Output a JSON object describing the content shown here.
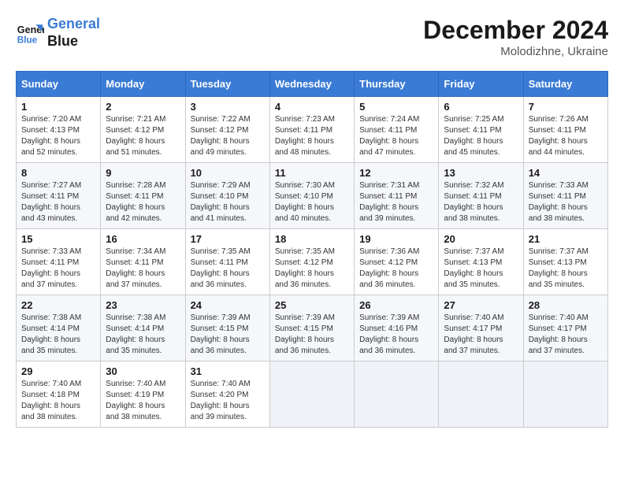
{
  "header": {
    "logo_line1": "General",
    "logo_line2": "Blue",
    "month": "December 2024",
    "location": "Molodizhne, Ukraine"
  },
  "weekdays": [
    "Sunday",
    "Monday",
    "Tuesday",
    "Wednesday",
    "Thursday",
    "Friday",
    "Saturday"
  ],
  "weeks": [
    [
      {
        "day": "1",
        "sunrise": "7:20 AM",
        "sunset": "4:13 PM",
        "daylight": "8 hours and 52 minutes."
      },
      {
        "day": "2",
        "sunrise": "7:21 AM",
        "sunset": "4:12 PM",
        "daylight": "8 hours and 51 minutes."
      },
      {
        "day": "3",
        "sunrise": "7:22 AM",
        "sunset": "4:12 PM",
        "daylight": "8 hours and 49 minutes."
      },
      {
        "day": "4",
        "sunrise": "7:23 AM",
        "sunset": "4:11 PM",
        "daylight": "8 hours and 48 minutes."
      },
      {
        "day": "5",
        "sunrise": "7:24 AM",
        "sunset": "4:11 PM",
        "daylight": "8 hours and 47 minutes."
      },
      {
        "day": "6",
        "sunrise": "7:25 AM",
        "sunset": "4:11 PM",
        "daylight": "8 hours and 45 minutes."
      },
      {
        "day": "7",
        "sunrise": "7:26 AM",
        "sunset": "4:11 PM",
        "daylight": "8 hours and 44 minutes."
      }
    ],
    [
      {
        "day": "8",
        "sunrise": "7:27 AM",
        "sunset": "4:11 PM",
        "daylight": "8 hours and 43 minutes."
      },
      {
        "day": "9",
        "sunrise": "7:28 AM",
        "sunset": "4:11 PM",
        "daylight": "8 hours and 42 minutes."
      },
      {
        "day": "10",
        "sunrise": "7:29 AM",
        "sunset": "4:10 PM",
        "daylight": "8 hours and 41 minutes."
      },
      {
        "day": "11",
        "sunrise": "7:30 AM",
        "sunset": "4:10 PM",
        "daylight": "8 hours and 40 minutes."
      },
      {
        "day": "12",
        "sunrise": "7:31 AM",
        "sunset": "4:11 PM",
        "daylight": "8 hours and 39 minutes."
      },
      {
        "day": "13",
        "sunrise": "7:32 AM",
        "sunset": "4:11 PM",
        "daylight": "8 hours and 38 minutes."
      },
      {
        "day": "14",
        "sunrise": "7:33 AM",
        "sunset": "4:11 PM",
        "daylight": "8 hours and 38 minutes."
      }
    ],
    [
      {
        "day": "15",
        "sunrise": "7:33 AM",
        "sunset": "4:11 PM",
        "daylight": "8 hours and 37 minutes."
      },
      {
        "day": "16",
        "sunrise": "7:34 AM",
        "sunset": "4:11 PM",
        "daylight": "8 hours and 37 minutes."
      },
      {
        "day": "17",
        "sunrise": "7:35 AM",
        "sunset": "4:11 PM",
        "daylight": "8 hours and 36 minutes."
      },
      {
        "day": "18",
        "sunrise": "7:35 AM",
        "sunset": "4:12 PM",
        "daylight": "8 hours and 36 minutes."
      },
      {
        "day": "19",
        "sunrise": "7:36 AM",
        "sunset": "4:12 PM",
        "daylight": "8 hours and 36 minutes."
      },
      {
        "day": "20",
        "sunrise": "7:37 AM",
        "sunset": "4:13 PM",
        "daylight": "8 hours and 35 minutes."
      },
      {
        "day": "21",
        "sunrise": "7:37 AM",
        "sunset": "4:13 PM",
        "daylight": "8 hours and 35 minutes."
      }
    ],
    [
      {
        "day": "22",
        "sunrise": "7:38 AM",
        "sunset": "4:14 PM",
        "daylight": "8 hours and 35 minutes."
      },
      {
        "day": "23",
        "sunrise": "7:38 AM",
        "sunset": "4:14 PM",
        "daylight": "8 hours and 35 minutes."
      },
      {
        "day": "24",
        "sunrise": "7:39 AM",
        "sunset": "4:15 PM",
        "daylight": "8 hours and 36 minutes."
      },
      {
        "day": "25",
        "sunrise": "7:39 AM",
        "sunset": "4:15 PM",
        "daylight": "8 hours and 36 minutes."
      },
      {
        "day": "26",
        "sunrise": "7:39 AM",
        "sunset": "4:16 PM",
        "daylight": "8 hours and 36 minutes."
      },
      {
        "day": "27",
        "sunrise": "7:40 AM",
        "sunset": "4:17 PM",
        "daylight": "8 hours and 37 minutes."
      },
      {
        "day": "28",
        "sunrise": "7:40 AM",
        "sunset": "4:17 PM",
        "daylight": "8 hours and 37 minutes."
      }
    ],
    [
      {
        "day": "29",
        "sunrise": "7:40 AM",
        "sunset": "4:18 PM",
        "daylight": "8 hours and 38 minutes."
      },
      {
        "day": "30",
        "sunrise": "7:40 AM",
        "sunset": "4:19 PM",
        "daylight": "8 hours and 38 minutes."
      },
      {
        "day": "31",
        "sunrise": "7:40 AM",
        "sunset": "4:20 PM",
        "daylight": "8 hours and 39 minutes."
      },
      null,
      null,
      null,
      null
    ]
  ]
}
